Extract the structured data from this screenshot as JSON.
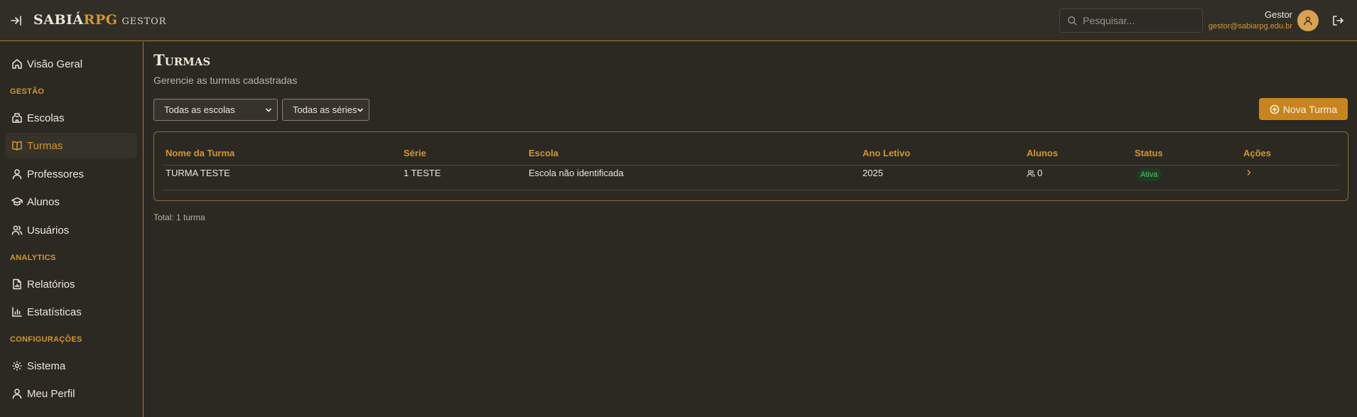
{
  "app": {
    "brand_part1": "SABIÁ",
    "brand_part2": "RPG",
    "brand_part3": "GESTOR"
  },
  "header": {
    "search_placeholder": "Pesquisar...",
    "user_name": "Gestor",
    "user_email": "gestor@sabiarpg.edu.br"
  },
  "sidebar": {
    "overview": "Visão Geral",
    "sections": {
      "gestao": "GESTÃO",
      "analytics": "ANALYTICS",
      "config": "CONFIGURAÇÕES"
    },
    "items": {
      "escolas": "Escolas",
      "turmas": "Turmas",
      "professores": "Professores",
      "alunos": "Alunos",
      "usuarios": "Usuários",
      "relatorios": "Relatórios",
      "estatisticas": "Estatísticas",
      "sistema": "Sistema",
      "perfil": "Meu Perfil"
    },
    "active_item": "turmas"
  },
  "page": {
    "title": "Turmas",
    "subtitle": "Gerencie as turmas cadastradas",
    "filter_school": "Todas as escolas",
    "filter_grade": "Todas as séries",
    "new_button": "Nova Turma",
    "total": "Total: 1 turma"
  },
  "table": {
    "columns": [
      "Nome da Turma",
      "Série",
      "Escola",
      "Ano Letivo",
      "Alunos",
      "Status",
      "Ações"
    ],
    "rows": [
      {
        "name": "TURMA TESTE",
        "grade": "1 TESTE",
        "school": "Escola não identificada",
        "year": "2025",
        "students": "0",
        "status": "Ativa"
      }
    ]
  },
  "colors": {
    "accent": "#d4962e",
    "button": "#c8841e",
    "background": "#2b2922",
    "status_active": "#5cc46a"
  },
  "icons": {
    "collapse": "collapse-sidebar-icon",
    "search": "search-icon",
    "avatar": "user-icon",
    "logout": "logout-icon",
    "new": "plus-circle-icon",
    "students": "users-icon",
    "row_action": "chevron-right-icon"
  }
}
